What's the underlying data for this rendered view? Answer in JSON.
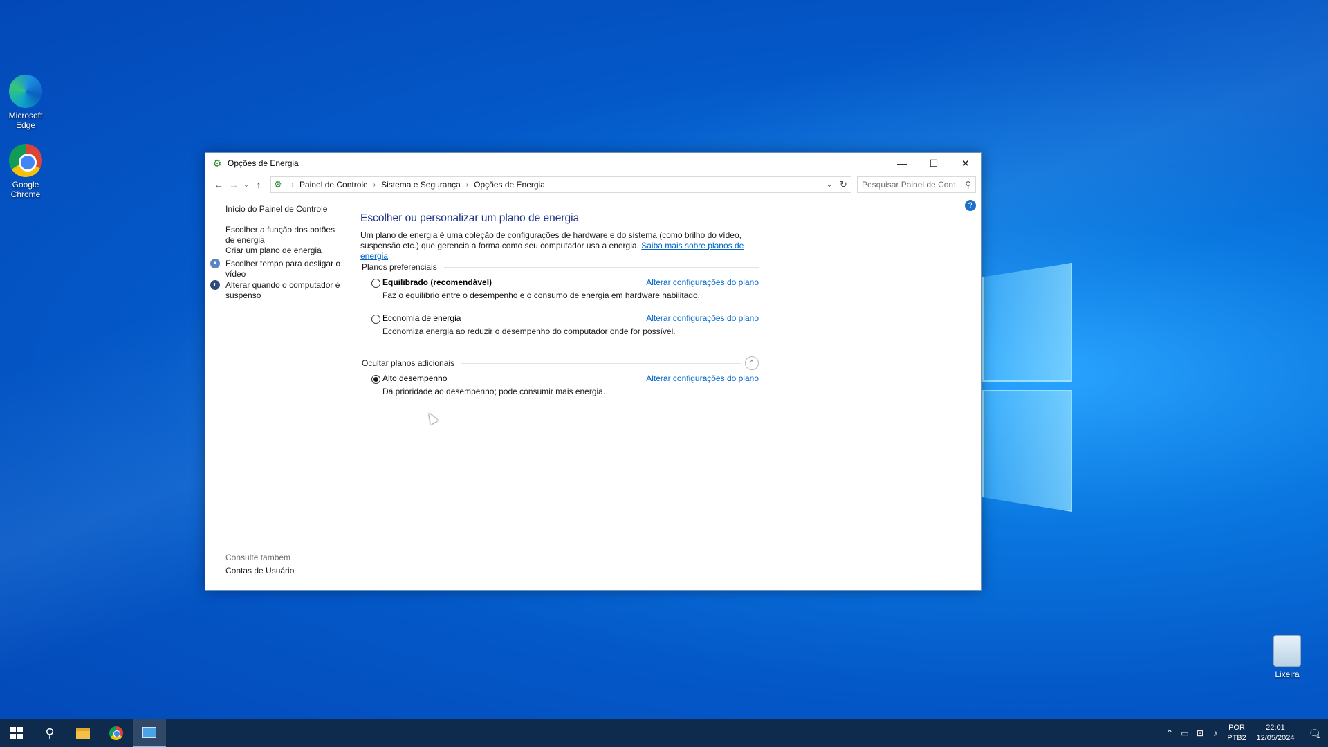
{
  "desktop": {
    "icons": [
      {
        "label": "Microsoft Edge"
      },
      {
        "label": "Google Chrome"
      },
      {
        "label": "Lixeira"
      }
    ]
  },
  "window": {
    "title": "Opções de Energia",
    "controls": {
      "minimize": "—",
      "maximize": "☐",
      "close": "✕"
    },
    "address": {
      "crumbs": [
        "Painel de Controle",
        "Sistema e Segurança",
        "Opções de Energia"
      ]
    },
    "search": {
      "placeholder": "Pesquisar Painel de Cont..."
    },
    "help": "?",
    "sidebar": {
      "links": [
        "Início do Painel de Controle",
        "Escolher a função dos botões de energia",
        "Criar um plano de energia",
        "Escolher tempo para desligar o vídeo",
        "Alterar quando o computador é suspenso"
      ],
      "see_also_title": "Consulte também",
      "see_also_links": [
        "Contas de Usuário"
      ]
    },
    "main": {
      "heading": "Escolher ou personalizar um plano de energia",
      "description": "Um plano de energia é uma coleção de configurações de hardware e do sistema (como brilho do vídeo, suspensão etc.) que gerencia a forma como seu computador usa a energia.",
      "learn_more": "Saiba mais sobre planos de energia",
      "preferred_title": "Planos preferenciais",
      "additional_title": "Ocultar planos adicionais",
      "change_label": "Alterar configurações do plano",
      "plans": [
        {
          "name": "Equilibrado (recomendável)",
          "description": "Faz o equilíbrio entre o desempenho e o consumo de energia em hardware habilitado.",
          "selected": false
        },
        {
          "name": "Economia de energia",
          "description": "Economiza energia ao reduzir o desempenho do computador onde for possível.",
          "selected": false
        },
        {
          "name": "Alto desempenho",
          "description": "Dá prioridade ao desempenho; pode consumir mais energia.",
          "selected": true
        }
      ]
    }
  },
  "taskbar": {
    "language": {
      "line1": "POR",
      "line2": "PTB2"
    },
    "clock": {
      "time": "22:01",
      "date": "12/05/2024"
    },
    "notification_count": "1"
  }
}
